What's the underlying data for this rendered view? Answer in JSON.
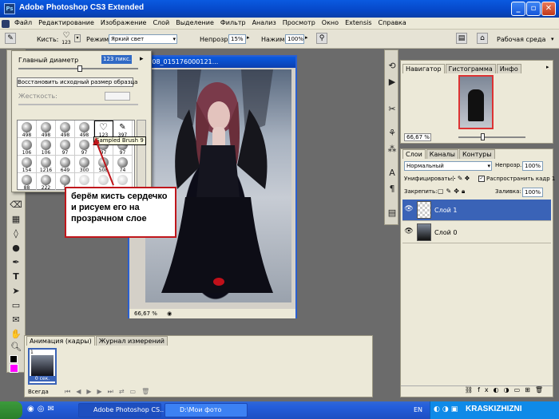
{
  "window": {
    "title": "Adobe Photoshop CS3 Extended",
    "app_icon": "Ps"
  },
  "menu": [
    "Файл",
    "Редактирование",
    "Изображение",
    "Слой",
    "Выделение",
    "Фильтр",
    "Анализ",
    "Просмотр",
    "Окно",
    "Extensis",
    "Справка"
  ],
  "options": {
    "brush_label": "Кисть:",
    "brush_size": "123",
    "mode_label": "Режим:",
    "mode_value": "Яркий свет",
    "opacity_label": "Непрозр.:",
    "opacity_value": "15%",
    "flow_label": "Нажим:",
    "flow_value": "100%",
    "workspace_label": "Рабочая среда"
  },
  "brush_panel": {
    "diameter_label": "Главный диаметр",
    "diameter_value": "123 пикс.",
    "restore_button": "Восстановить исходный размер образца",
    "hardness_label": "Жесткость:",
    "rows": [
      [
        "498",
        "498",
        "498",
        "498",
        "123",
        "397"
      ],
      [
        "106",
        "106",
        "97",
        "97",
        "97",
        "97"
      ],
      [
        "154",
        "1216",
        "649",
        "300",
        "508",
        "74"
      ],
      [
        "88",
        "222",
        "5",
        "",
        "",
        ""
      ]
    ],
    "tooltip": "Sampled Brush 9"
  },
  "document": {
    "title": "05_2008_015176000121...",
    "zoom": "66,67 %"
  },
  "note": "берём кисть сердечко и рисуем его на прозрачном слое",
  "navigator": {
    "tabs": [
      "Навигатор",
      "Гистограмма",
      "Инфо"
    ],
    "zoom": "66,67 %"
  },
  "layers": {
    "tabs": [
      "Слои",
      "Каналы",
      "Контуры"
    ],
    "blend_mode": "Нормальный",
    "opacity_label": "Непрозр.:",
    "opacity_value": "100%",
    "unify_label": "Унифицировать:",
    "propagate_label": "Распространить кадр 1",
    "lock_label": "Закрепить:",
    "fill_label": "Заливка:",
    "fill_value": "100%",
    "items": [
      {
        "name": "Слой 1",
        "selected": true
      },
      {
        "name": "Слой 0",
        "selected": false
      }
    ]
  },
  "animation": {
    "tabs": [
      "Анимация (кадры)",
      "Журнал измерений"
    ],
    "frame_number": "1",
    "frame_delay": "0 сек.",
    "loop": "Всегда"
  },
  "taskbar": {
    "tasks": [
      "Adobe Photoshop CS...",
      "D:\\Мои фото"
    ],
    "lang": "EN",
    "watermark": "KRASKIZHIZNI"
  },
  "colors": {
    "xp_blue": "#0a5ae0",
    "note_border": "#c0161b",
    "layer_selected": "#3a63b7",
    "foreground": "#000000",
    "background": "#ff00ff"
  }
}
